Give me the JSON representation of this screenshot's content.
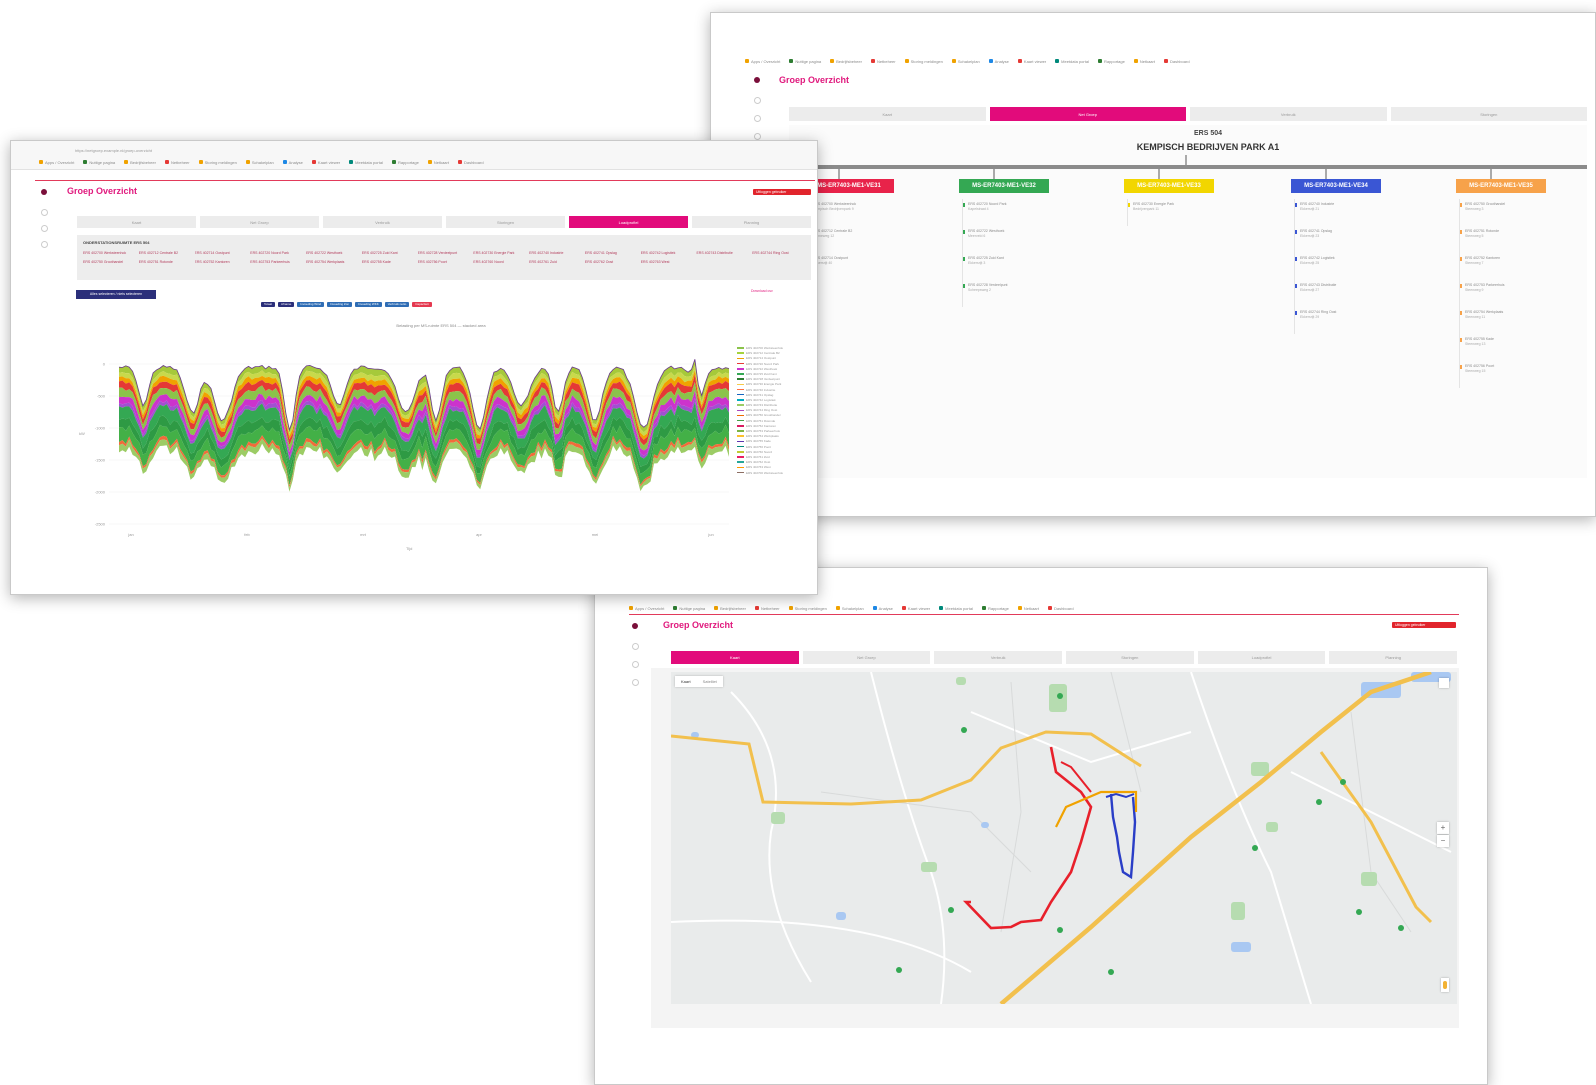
{
  "app": {
    "title": "Groep Overzicht",
    "accent_color": "#e20b7b",
    "user_badge": "Uitloggen gebruiker"
  },
  "bookmarks": [
    {
      "label": "Apps / Overzicht",
      "color": "#f0a200"
    },
    {
      "label": "Nuttige pagina",
      "color": "#2e7d32"
    },
    {
      "label": "Bedrijfsbeheer",
      "color": "#f0a200"
    },
    {
      "label": "Netbeheer",
      "color": "#e53935"
    },
    {
      "label": "Storing meldingen",
      "color": "#f0a200"
    },
    {
      "label": "Schakelplan",
      "color": "#f0a200"
    },
    {
      "label": "Analyse",
      "color": "#1e88e5"
    },
    {
      "label": "Kaart viewer",
      "color": "#e53935"
    },
    {
      "label": "Meetdata portal",
      "color": "#00897b"
    },
    {
      "label": "Rapportage",
      "color": "#2e7d32"
    },
    {
      "label": "Netkaart",
      "color": "#f0a200"
    },
    {
      "label": "Dashboard",
      "color": "#e53935"
    }
  ],
  "topology": {
    "tabs": [
      {
        "label": "Kaart",
        "active": false
      },
      {
        "label": "Net Groep",
        "active": true
      },
      {
        "label": "Verbruik",
        "active": false
      },
      {
        "label": "Storingen",
        "active": false
      }
    ],
    "station_code": "ERS 504",
    "station_name": "KEMPISCH BEDRIJVEN PARK A1",
    "feeders": [
      {
        "label": "MS-ER7403-ME1-VE31",
        "color": "#e8234a",
        "subs": [
          {
            "code": "ERS 402700 Werksteenhok",
            "address": "Kempisch Bedrijvenpark 9"
          },
          {
            "code": "ERS 402712 Centrale B2",
            "address": "Zonneweg 12"
          },
          {
            "code": "ERS 402714 Oostpunt",
            "address": "Ekkersrijt 40"
          }
        ]
      },
      {
        "label": "MS-ER7403-ME1-VE32",
        "color": "#34a853",
        "subs": [
          {
            "code": "ERS 402720 Noord Park",
            "address": "Kapelstraat 4"
          },
          {
            "code": "ERS 402722 Westhoek",
            "address": "Meerveld 6"
          },
          {
            "code": "ERS 402725 Zuid Kant",
            "address": "Ekkersrijt 3"
          },
          {
            "code": "ERS 402728 Verdeelpunt",
            "address": "Scheepsweg 2"
          }
        ]
      },
      {
        "label": "MS-ER7403-ME1-VE33",
        "color": "#f2d600",
        "subs": [
          {
            "code": "ERS 402730 Energie Park",
            "address": "Bedrijvenpark 11"
          }
        ]
      },
      {
        "label": "MS-ER7403-ME1-VE34",
        "color": "#3a56d4",
        "subs": [
          {
            "code": "ERS 402740 Industrie",
            "address": "Ekkersrijt 21"
          },
          {
            "code": "ERS 402741 Opslag",
            "address": "Ekkersrijt 23"
          },
          {
            "code": "ERS 402742 Logistiek",
            "address": "Ekkersrijt 25"
          },
          {
            "code": "ERS 402743 Distributie",
            "address": "Ekkersrijt 27"
          },
          {
            "code": "ERS 402744 Ring Oost",
            "address": "Ekkersrijt 29"
          }
        ]
      },
      {
        "label": "MS-ER7403-ME1-VE35",
        "color": "#f7a24a",
        "subs": [
          {
            "code": "ERS 402750 Groothandel",
            "address": "Steenweg 3"
          },
          {
            "code": "ERS 402751 Rotonde",
            "address": "Steenweg 5"
          },
          {
            "code": "ERS 402752 Kantoren",
            "address": "Steenweg 7"
          },
          {
            "code": "ERS 402753 Parkeerhuis",
            "address": "Steenweg 9"
          },
          {
            "code": "ERS 402754 Werkplaats",
            "address": "Steenweg 11"
          },
          {
            "code": "ERS 402755 Kade",
            "address": "Steenweg 13"
          },
          {
            "code": "ERS 402756 Poort",
            "address": "Steenweg 15"
          }
        ]
      }
    ]
  },
  "chart_window": {
    "url": "https://netgroep.example.nl/groep-overzicht",
    "tabs": [
      {
        "label": "Kaart",
        "active": false
      },
      {
        "label": "Net Groep",
        "active": false
      },
      {
        "label": "Verbruik",
        "active": false
      },
      {
        "label": "Storingen",
        "active": false
      },
      {
        "label": "Loadprofiel",
        "active": true
      },
      {
        "label": "Planning",
        "active": false
      }
    ],
    "panel_title": "ONDERSTATIONSRUIMTE ERS 504",
    "stations": [
      "ERS 402700 Werksteenhok",
      "ERS 402712 Centrale B2",
      "ERS 402714 Oostpunt",
      "ERS 402720 Noord Park",
      "ERS 402722 Westhoek",
      "ERS 402725 Zuid Kant",
      "ERS 402728 Verdeelpunt",
      "ERS 402730 Energie Park",
      "ERS 402740 Industrie",
      "ERS 402741 Opslag",
      "ERS 402742 Logistiek",
      "ERS 402743 Distributie",
      "ERS 402744 Ring Oost",
      "ERS 402750 Groothandel",
      "ERS 402751 Rotonde",
      "ERS 402752 Kantoren",
      "ERS 402753 Parkeerhuis",
      "ERS 402754 Werkplaats",
      "ERS 402755 Kade",
      "ERS 402756 Poort",
      "ERS 402760 Noord",
      "ERS 402761 Zuid",
      "ERS 402762 Oost",
      "ERS 402763 West"
    ],
    "action_button": "Alles selecteren / niets selecteren",
    "right_link": "Download csv",
    "chips": [
      {
        "label": "Totaal",
        "color": "#2b2f7a"
      },
      {
        "label": "Afname",
        "color": "#2b2f7a"
      },
      {
        "label": "Invoeding Wind",
        "color": "#2f6db5"
      },
      {
        "label": "Invoeding Zon",
        "color": "#2f6db5"
      },
      {
        "label": "Invoeding WKK",
        "color": "#2f6db5"
      },
      {
        "label": "Verbruik netto",
        "color": "#2f6db5"
      },
      {
        "label": "Capaciteit",
        "color": "#e53950"
      }
    ],
    "chart_caption": "Belasting per MS-ruimte ERS 504 — stacked area",
    "y_label": "kW",
    "x_label": "Tijd",
    "x_ticks": [
      "jan",
      "feb",
      "mrt",
      "apr",
      "mei",
      "jun"
    ],
    "y_ticks": [
      "0",
      "-500",
      "-1000",
      "-1500",
      "-2000",
      "-2500"
    ],
    "legend_colors": [
      "#8bc34a",
      "#a6d33d",
      "#f0a200",
      "#e53935",
      "#cc33cc",
      "#34a853",
      "#2e7d32",
      "#f7c948",
      "#ff7043",
      "#1565c0",
      "#00acc1",
      "#9ccc65",
      "#ab47bc",
      "#ef6c00",
      "#43a047",
      "#d81b60",
      "#7cb342",
      "#fbc02d",
      "#5e35b1",
      "#00897b",
      "#c0ca33",
      "#e91e63",
      "#26a69a",
      "#ff9800",
      "#8d6e63"
    ]
  },
  "map_window": {
    "tabs": [
      {
        "label": "Kaart",
        "active": true
      },
      {
        "label": "Net Groep",
        "active": false
      },
      {
        "label": "Verbruik",
        "active": false
      },
      {
        "label": "Storingen",
        "active": false
      },
      {
        "label": "Loadprofiel",
        "active": false
      },
      {
        "label": "Planning",
        "active": false
      }
    ],
    "map_type_options": [
      "Kaart",
      "Satelliet"
    ],
    "map_colors": {
      "road": "#f2c04d",
      "feeder_red": "#e8202b",
      "feeder_blue": "#2a3ec7",
      "feeder_orange": "#f0a200",
      "park": "#b6dcb0",
      "water": "#a9c8f2"
    }
  }
}
